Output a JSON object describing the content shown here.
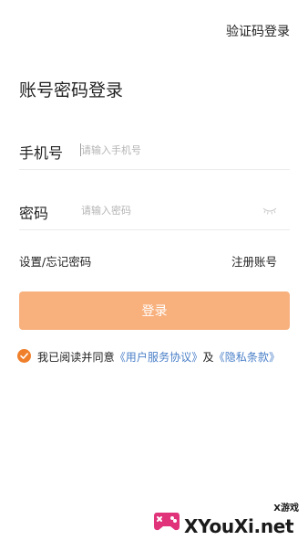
{
  "header": {
    "switch_login_label": "验证码登录"
  },
  "page": {
    "title": "账号密码登录"
  },
  "phone_field": {
    "label": "手机号",
    "placeholder": "请输入手机号",
    "value": ""
  },
  "password_field": {
    "label": "密码",
    "placeholder": "请输入密码",
    "value": "",
    "toggle_icon": "eye-closed-icon"
  },
  "links": {
    "forgot_password": "设置/忘记密码",
    "register": "注册账号"
  },
  "login_button": {
    "label": "登录",
    "color": "#f8b07d",
    "enabled": false
  },
  "agreement": {
    "checked": true,
    "check_color": "#f07f2c",
    "prefix": "我已阅读并同意",
    "user_agreement": "《用户服务协议》",
    "conjunction": "及",
    "privacy_policy": "《隐私条款》",
    "link_color": "#4a7fc8"
  },
  "watermark": {
    "brand": "XYouXi.net",
    "subtitle": "X游戏"
  }
}
